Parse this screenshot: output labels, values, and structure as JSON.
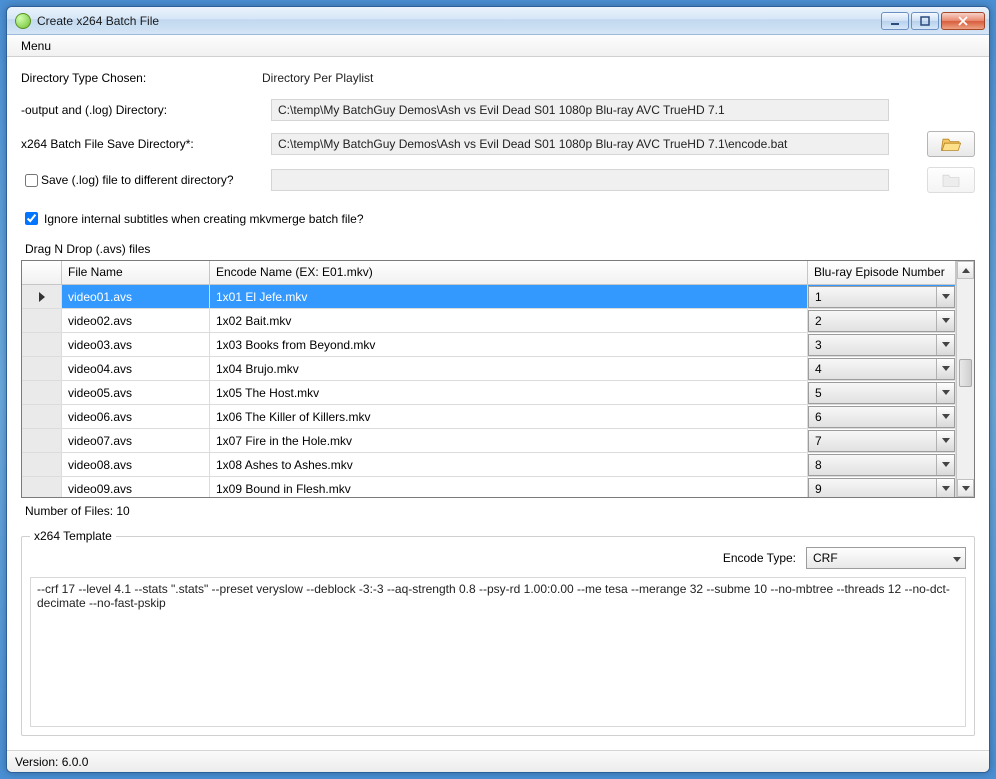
{
  "window": {
    "title": "Create x264 Batch File"
  },
  "menu": {
    "label": "Menu"
  },
  "fields": {
    "dirTypeLabel": "Directory Type Chosen:",
    "dirTypeValue": "Directory Per Playlist",
    "outputDirLabel": "-output and (.log) Directory:",
    "outputDirValue": "C:\\temp\\My BatchGuy Demos\\Ash vs Evil Dead S01 1080p Blu-ray AVC TrueHD 7.1",
    "saveDirLabel": "x264 Batch File Save Directory*:",
    "saveDirValue": "C:\\temp\\My BatchGuy Demos\\Ash vs Evil Dead S01 1080p Blu-ray AVC TrueHD 7.1\\encode.bat",
    "saveLogChkLabel": "Save (.log) file to different directory?",
    "saveLogChecked": false,
    "ignoreSubsLabel": "Ignore internal subtitles when creating mkvmerge batch file?",
    "ignoreSubsChecked": true
  },
  "grid": {
    "groupLabel": "Drag N Drop (.avs) files",
    "headers": {
      "file": "File Name",
      "encode": "Encode Name (EX: E01.mkv)",
      "episode": "Blu-ray Episode Number"
    },
    "rows": [
      {
        "file": "video01.avs",
        "encode": "1x01 El Jefe.mkv",
        "episode": "1",
        "selected": true
      },
      {
        "file": "video02.avs",
        "encode": "1x02 Bait.mkv",
        "episode": "2",
        "selected": false
      },
      {
        "file": "video03.avs",
        "encode": "1x03 Books from Beyond.mkv",
        "episode": "3",
        "selected": false
      },
      {
        "file": "video04.avs",
        "encode": "1x04 Brujo.mkv",
        "episode": "4",
        "selected": false
      },
      {
        "file": "video05.avs",
        "encode": "1x05 The Host.mkv",
        "episode": "5",
        "selected": false
      },
      {
        "file": "video06.avs",
        "encode": "1x06 The Killer of Killers.mkv",
        "episode": "6",
        "selected": false
      },
      {
        "file": "video07.avs",
        "encode": "1x07 Fire in the Hole.mkv",
        "episode": "7",
        "selected": false
      },
      {
        "file": "video08.avs",
        "encode": "1x08 Ashes to Ashes.mkv",
        "episode": "8",
        "selected": false
      },
      {
        "file": "video09.avs",
        "encode": "1x09 Bound in Flesh.mkv",
        "episode": "9",
        "selected": false
      }
    ],
    "countLabel": "Number of Files: 10"
  },
  "template": {
    "legend": "x264 Template",
    "encodeTypeLabel": "Encode Type:",
    "encodeTypeValue": "CRF",
    "text": "--crf 17 --level 4.1 --stats \".stats\" --preset veryslow --deblock -3:-3 --aq-strength 0.8 --psy-rd 1.00:0.00 --me tesa --merange 32 --subme 10 --no-mbtree --threads 12 --no-dct-decimate --no-fast-pskip"
  },
  "status": {
    "version": "Version: 6.0.0"
  }
}
